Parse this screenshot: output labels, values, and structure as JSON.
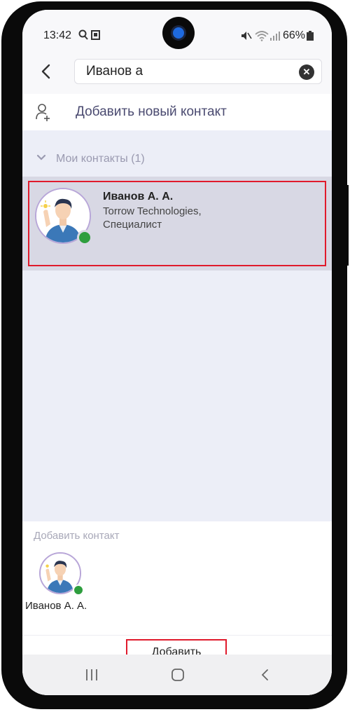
{
  "status_bar": {
    "time": "13:42",
    "battery": "66%"
  },
  "search": {
    "value": "Иванов а"
  },
  "add_new_contact": {
    "label": "Добавить новый контакт"
  },
  "group": {
    "label": "Мои контакты (1)"
  },
  "contact": {
    "name": "Иванов А. А.",
    "company": "Torrow Technologies,",
    "position": "Специалист",
    "status": "online"
  },
  "selected": {
    "title": "Добавить контакт",
    "name": "Иванов А. А."
  },
  "add_button": {
    "label": "Добавить"
  },
  "colors": {
    "accent": "#4a4a70",
    "highlight_border": "#e01a2c",
    "online": "#2e9e3e",
    "selected_row": "#d8d8e4"
  }
}
